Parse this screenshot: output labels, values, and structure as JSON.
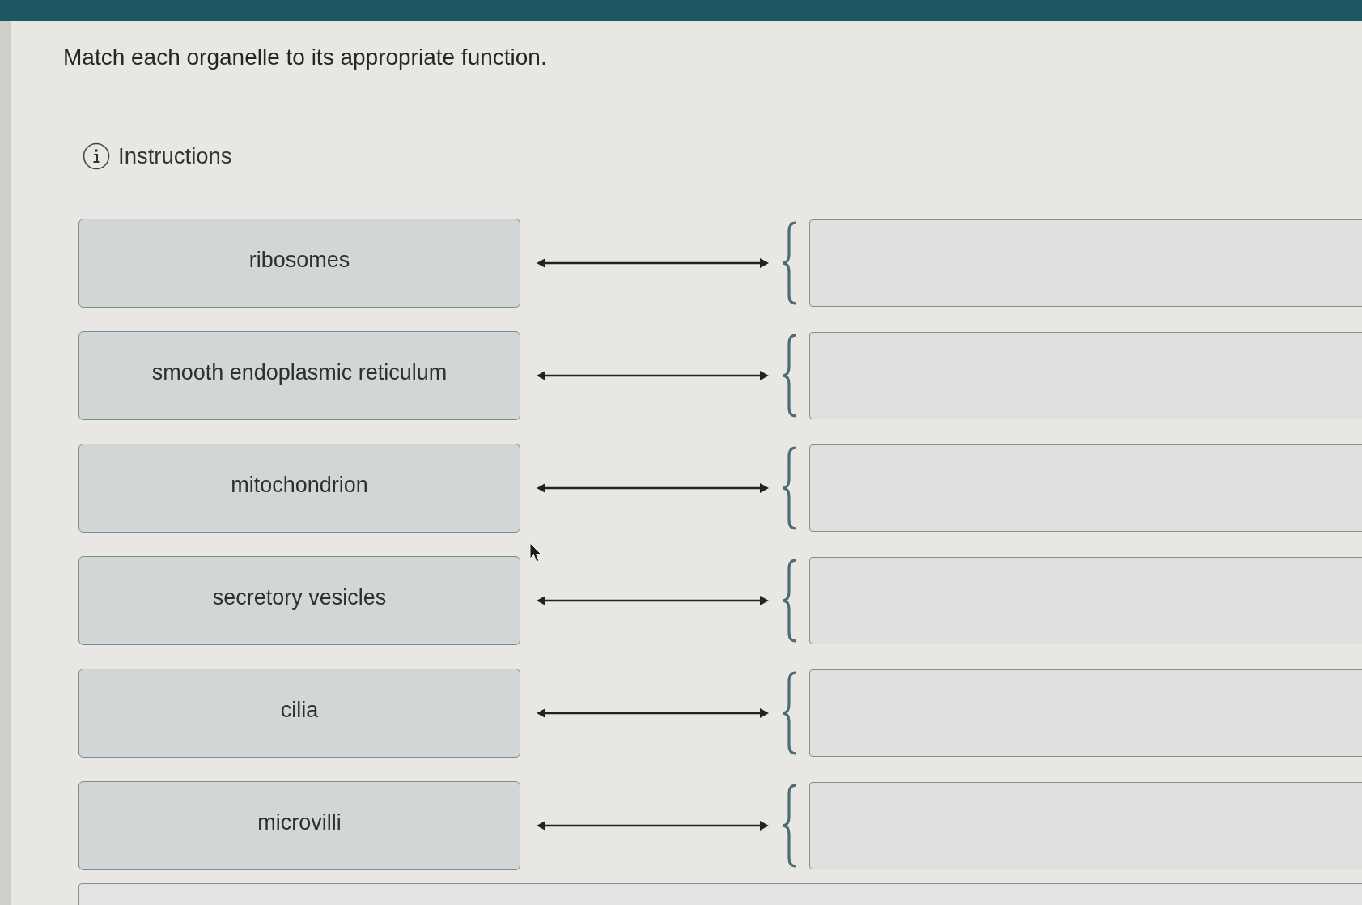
{
  "question": {
    "prompt": "Match each organelle to its appropriate function.",
    "instructions_label": "Instructions"
  },
  "pairs": [
    {
      "organelle": "ribosomes"
    },
    {
      "organelle": "smooth endoplasmic reticulum"
    },
    {
      "organelle": "mitochondrion"
    },
    {
      "organelle": "secretory vesicles"
    },
    {
      "organelle": "cilia"
    },
    {
      "organelle": "microvilli"
    }
  ],
  "more_below": true
}
